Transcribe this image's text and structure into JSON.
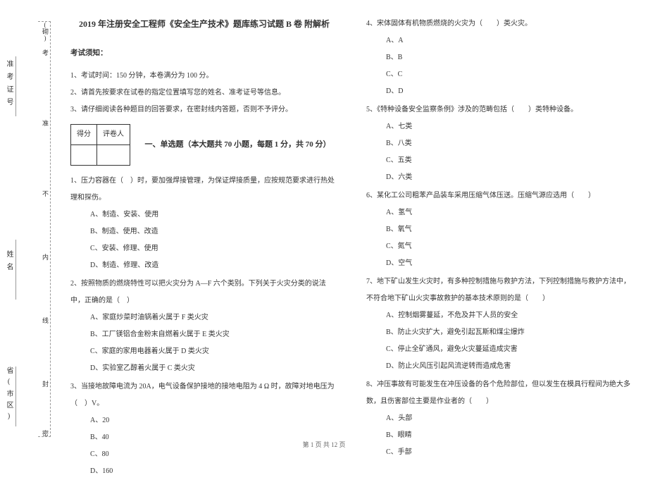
{
  "header": {
    "title": "2019 年注册安全工程师《安全生产技术》题库练习试题 B 卷 附解析",
    "notice_heading": "考试须知：",
    "notices": [
      "1、考试时间：150 分钟，本卷满分为 100 分。",
      "2、请首先按要求在试卷的指定位置填写您的姓名、准考证号等信息。",
      "3、请仔细阅读各种题目的回答要求，在密封线内答题，否则不予评分。"
    ]
  },
  "score_table": {
    "c1": "得分",
    "c2": "评卷人"
  },
  "section1_title": "一、单选题（本大题共 70 小题，每题 1 分，共 70 分）",
  "questions_left": [
    {
      "stem": "1、压力容器在（　）时，要加强焊接管理，为保证焊接质量，应按规范要求进行热处理和探伤。",
      "opts": [
        "A、制造、安装、使用",
        "B、制造、使用、改造",
        "C、安装、修理、使用",
        "D、制造、修理、改造"
      ]
    },
    {
      "stem": "2、按照物质的燃烧特性可以把火灾分为 A—F 六个类别。下列关于火灾分类的说法中，正确的是（　）",
      "opts": [
        "A、家庭炒菜时油锅着火属于 F 类火灾",
        "B、工厂镁铝合金粉末自燃着火属于 E 类火灾",
        "C、家庭的家用电器着火属于 D 类火灾",
        "D、实验室乙醇着火属于 C 类火灾"
      ]
    },
    {
      "stem": "3、当接地故障电流为 20A，电气设备保护接地的接地电阻为 4 Ω 时，故障对地电压为（　）V。",
      "opts": [
        "A、20",
        "B、40",
        "C、80",
        "D、160"
      ]
    }
  ],
  "questions_right": [
    {
      "stem": "4、宋体固体有机物质燃烧的火灾为（　　）类火灾。",
      "opts": [
        "A、A",
        "B、B",
        "C、C",
        "D、D"
      ]
    },
    {
      "stem": "5、《特种设备安全监察条例》涉及的范畴包括（　　）类特种设备。",
      "opts": [
        "A、七类",
        "B、八类",
        "C、五类",
        "D、六类"
      ]
    },
    {
      "stem": "6、某化工公司粗苯产品装车采用压缩气体压送。压缩气源应选用（　　）",
      "opts": [
        "A、氢气",
        "B、氧气",
        "C、氮气",
        "D、空气"
      ]
    },
    {
      "stem": "7、地下矿山发生火灾时，有多种控制措施与救护方法，下列控制措施与救护方法中，不符合地下矿山火灾事故救护的基本技术原则的是（　　）",
      "opts": [
        "A、控制烟雾蔓延，不危及井下人员的安全",
        "B、防止火灾扩大，避免引起瓦斯和煤尘爆炸",
        "C、停止全矿通风，避免火灾蔓延造成灾害",
        "D、防止火风压引起风流逆转而造成危害"
      ]
    },
    {
      "stem": "8、冲压事故有可能发生在冲压设备的各个危险部位，但以发生在模具行程间为绝大多数，且伤害部位主要是作业者的（　　）",
      "opts": [
        "A、头部",
        "B、眼睛",
        "C、手部"
      ]
    }
  ],
  "side_labels": {
    "zhunkaohao": "准考证号",
    "zhun": "准",
    "xingming": "姓名",
    "shengshi": "省(市区)",
    "ke": "考",
    "bu": "不",
    "nei": "内",
    "xian": "线",
    "feng": "封",
    "mi": "密",
    "prov": "(砌)"
  },
  "footer": "第 1 页 共 12 页"
}
